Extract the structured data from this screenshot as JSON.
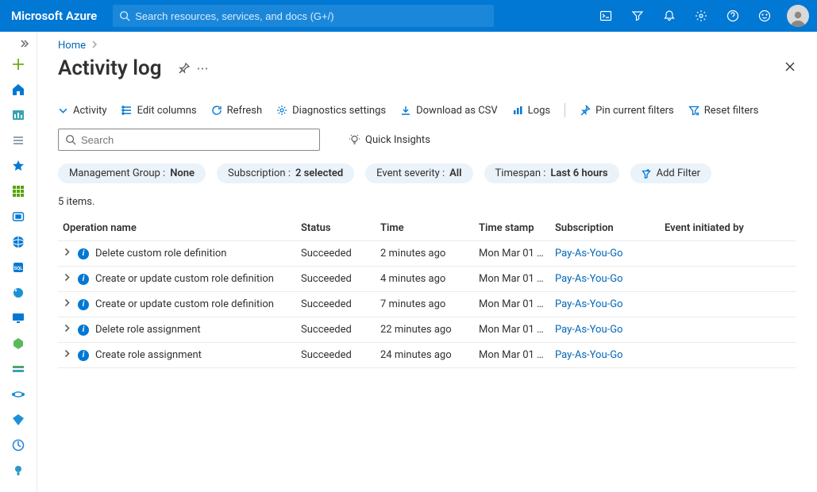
{
  "header": {
    "brand": "Microsoft Azure",
    "search_placeholder": "Search resources, services, and docs (G+/)"
  },
  "breadcrumb": {
    "home": "Home"
  },
  "page": {
    "title": "Activity log"
  },
  "toolbar": {
    "activity": "Activity",
    "edit_columns": "Edit columns",
    "refresh": "Refresh",
    "diagnostics": "Diagnostics settings",
    "download": "Download as CSV",
    "logs": "Logs",
    "pin": "Pin current filters",
    "reset": "Reset filters"
  },
  "search": {
    "placeholder": "Search",
    "quick_insights": "Quick Insights"
  },
  "filters": {
    "mgmt_label": "Management Group : ",
    "mgmt_value": "None",
    "sub_label": "Subscription : ",
    "sub_value": "2 selected",
    "severity_label": "Event severity : ",
    "severity_value": "All",
    "timespan_label": "Timespan : ",
    "timespan_value": "Last 6 hours",
    "add_filter": "Add Filter"
  },
  "table": {
    "count": "5 items.",
    "headers": {
      "op": "Operation name",
      "status": "Status",
      "time": "Time",
      "ts": "Time stamp",
      "sub": "Subscription",
      "by": "Event initiated by"
    },
    "rows": [
      {
        "op": "Delete custom role definition",
        "status": "Succeeded",
        "time": "2 minutes ago",
        "ts": "Mon Mar 01 …",
        "sub": "Pay-As-You-Go",
        "by": ""
      },
      {
        "op": "Create or update custom role definition",
        "status": "Succeeded",
        "time": "4 minutes ago",
        "ts": "Mon Mar 01 …",
        "sub": "Pay-As-You-Go",
        "by": ""
      },
      {
        "op": "Create or update custom role definition",
        "status": "Succeeded",
        "time": "7 minutes ago",
        "ts": "Mon Mar 01 …",
        "sub": "Pay-As-You-Go",
        "by": ""
      },
      {
        "op": "Delete role assignment",
        "status": "Succeeded",
        "time": "22 minutes ago",
        "ts": "Mon Mar 01 …",
        "sub": "Pay-As-You-Go",
        "by": ""
      },
      {
        "op": "Create role assignment",
        "status": "Succeeded",
        "time": "24 minutes ago",
        "ts": "Mon Mar 01 …",
        "sub": "Pay-As-You-Go",
        "by": ""
      }
    ]
  }
}
